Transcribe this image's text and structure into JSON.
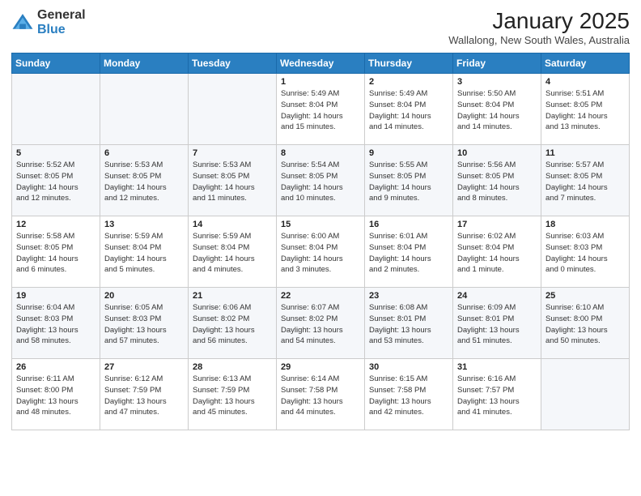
{
  "logo": {
    "general": "General",
    "blue": "Blue"
  },
  "header": {
    "month": "January 2025",
    "location": "Wallalong, New South Wales, Australia"
  },
  "days_of_week": [
    "Sunday",
    "Monday",
    "Tuesday",
    "Wednesday",
    "Thursday",
    "Friday",
    "Saturday"
  ],
  "weeks": [
    [
      {
        "num": "",
        "info": ""
      },
      {
        "num": "",
        "info": ""
      },
      {
        "num": "",
        "info": ""
      },
      {
        "num": "1",
        "info": "Sunrise: 5:49 AM\nSunset: 8:04 PM\nDaylight: 14 hours\nand 15 minutes."
      },
      {
        "num": "2",
        "info": "Sunrise: 5:49 AM\nSunset: 8:04 PM\nDaylight: 14 hours\nand 14 minutes."
      },
      {
        "num": "3",
        "info": "Sunrise: 5:50 AM\nSunset: 8:04 PM\nDaylight: 14 hours\nand 14 minutes."
      },
      {
        "num": "4",
        "info": "Sunrise: 5:51 AM\nSunset: 8:05 PM\nDaylight: 14 hours\nand 13 minutes."
      }
    ],
    [
      {
        "num": "5",
        "info": "Sunrise: 5:52 AM\nSunset: 8:05 PM\nDaylight: 14 hours\nand 12 minutes."
      },
      {
        "num": "6",
        "info": "Sunrise: 5:53 AM\nSunset: 8:05 PM\nDaylight: 14 hours\nand 12 minutes."
      },
      {
        "num": "7",
        "info": "Sunrise: 5:53 AM\nSunset: 8:05 PM\nDaylight: 14 hours\nand 11 minutes."
      },
      {
        "num": "8",
        "info": "Sunrise: 5:54 AM\nSunset: 8:05 PM\nDaylight: 14 hours\nand 10 minutes."
      },
      {
        "num": "9",
        "info": "Sunrise: 5:55 AM\nSunset: 8:05 PM\nDaylight: 14 hours\nand 9 minutes."
      },
      {
        "num": "10",
        "info": "Sunrise: 5:56 AM\nSunset: 8:05 PM\nDaylight: 14 hours\nand 8 minutes."
      },
      {
        "num": "11",
        "info": "Sunrise: 5:57 AM\nSunset: 8:05 PM\nDaylight: 14 hours\nand 7 minutes."
      }
    ],
    [
      {
        "num": "12",
        "info": "Sunrise: 5:58 AM\nSunset: 8:05 PM\nDaylight: 14 hours\nand 6 minutes."
      },
      {
        "num": "13",
        "info": "Sunrise: 5:59 AM\nSunset: 8:04 PM\nDaylight: 14 hours\nand 5 minutes."
      },
      {
        "num": "14",
        "info": "Sunrise: 5:59 AM\nSunset: 8:04 PM\nDaylight: 14 hours\nand 4 minutes."
      },
      {
        "num": "15",
        "info": "Sunrise: 6:00 AM\nSunset: 8:04 PM\nDaylight: 14 hours\nand 3 minutes."
      },
      {
        "num": "16",
        "info": "Sunrise: 6:01 AM\nSunset: 8:04 PM\nDaylight: 14 hours\nand 2 minutes."
      },
      {
        "num": "17",
        "info": "Sunrise: 6:02 AM\nSunset: 8:04 PM\nDaylight: 14 hours\nand 1 minute."
      },
      {
        "num": "18",
        "info": "Sunrise: 6:03 AM\nSunset: 8:03 PM\nDaylight: 14 hours\nand 0 minutes."
      }
    ],
    [
      {
        "num": "19",
        "info": "Sunrise: 6:04 AM\nSunset: 8:03 PM\nDaylight: 13 hours\nand 58 minutes."
      },
      {
        "num": "20",
        "info": "Sunrise: 6:05 AM\nSunset: 8:03 PM\nDaylight: 13 hours\nand 57 minutes."
      },
      {
        "num": "21",
        "info": "Sunrise: 6:06 AM\nSunset: 8:02 PM\nDaylight: 13 hours\nand 56 minutes."
      },
      {
        "num": "22",
        "info": "Sunrise: 6:07 AM\nSunset: 8:02 PM\nDaylight: 13 hours\nand 54 minutes."
      },
      {
        "num": "23",
        "info": "Sunrise: 6:08 AM\nSunset: 8:01 PM\nDaylight: 13 hours\nand 53 minutes."
      },
      {
        "num": "24",
        "info": "Sunrise: 6:09 AM\nSunset: 8:01 PM\nDaylight: 13 hours\nand 51 minutes."
      },
      {
        "num": "25",
        "info": "Sunrise: 6:10 AM\nSunset: 8:00 PM\nDaylight: 13 hours\nand 50 minutes."
      }
    ],
    [
      {
        "num": "26",
        "info": "Sunrise: 6:11 AM\nSunset: 8:00 PM\nDaylight: 13 hours\nand 48 minutes."
      },
      {
        "num": "27",
        "info": "Sunrise: 6:12 AM\nSunset: 7:59 PM\nDaylight: 13 hours\nand 47 minutes."
      },
      {
        "num": "28",
        "info": "Sunrise: 6:13 AM\nSunset: 7:59 PM\nDaylight: 13 hours\nand 45 minutes."
      },
      {
        "num": "29",
        "info": "Sunrise: 6:14 AM\nSunset: 7:58 PM\nDaylight: 13 hours\nand 44 minutes."
      },
      {
        "num": "30",
        "info": "Sunrise: 6:15 AM\nSunset: 7:58 PM\nDaylight: 13 hours\nand 42 minutes."
      },
      {
        "num": "31",
        "info": "Sunrise: 6:16 AM\nSunset: 7:57 PM\nDaylight: 13 hours\nand 41 minutes."
      },
      {
        "num": "",
        "info": ""
      }
    ]
  ]
}
